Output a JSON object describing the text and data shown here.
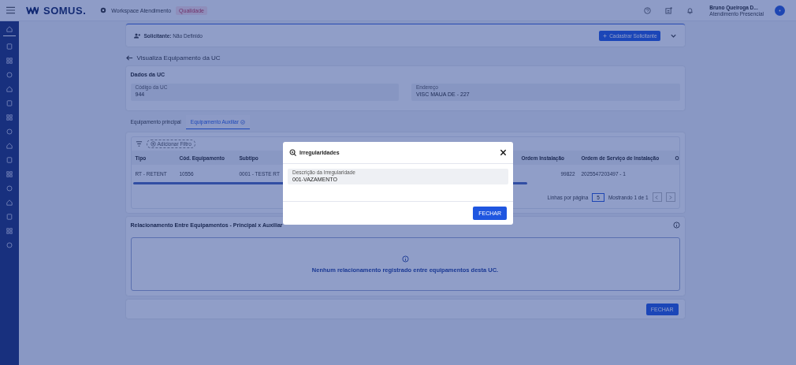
{
  "topbar": {
    "brand": "SOMUS.",
    "workspace": "Workspace Atendimento",
    "badge": "Qualidade",
    "user": {
      "name": "Bruno Queiroga D...",
      "role": "Atendimento Presencial"
    }
  },
  "sidebar": {
    "items": [
      {
        "selected": true
      },
      {
        "selected": false
      },
      {
        "selected": false
      },
      {
        "selected": false
      },
      {
        "selected": false
      },
      {
        "selected": false
      },
      {
        "selected": false
      },
      {
        "selected": false
      },
      {
        "selected": false
      },
      {
        "selected": false
      },
      {
        "selected": false
      },
      {
        "selected": false
      },
      {
        "selected": false
      },
      {
        "selected": false
      },
      {
        "selected": false
      },
      {
        "selected": false
      }
    ]
  },
  "requester": {
    "label": "Solicitante:",
    "value": "Não Definido",
    "button": "Cadastrar Solicitante"
  },
  "page_title": "Visualiza Equipamento da UC",
  "uc_data": {
    "title": "Dados da UC",
    "fields": [
      {
        "label": "Código da UC",
        "value": "944"
      },
      {
        "label": "Endereço",
        "value": "VISC MAUA DE - 227"
      }
    ]
  },
  "tabs": [
    {
      "label": "Equipamento principal",
      "selected": false
    },
    {
      "label": "Equipamento Auxiliar",
      "selected": true
    }
  ],
  "table": {
    "filter_button": "Adicionar Filtro",
    "columns": [
      {
        "label": "Tipo"
      },
      {
        "label": "Cód. Equipamento"
      },
      {
        "label": "Subtipo"
      },
      {
        "label": "Ordem Instalação"
      },
      {
        "label": "Ordem de Serviço de Instalação"
      },
      {
        "label": "O"
      }
    ],
    "rows": [
      {
        "cells": [
          "RT - RETENT",
          "10556",
          "0001 - TESTE RT",
          "99822",
          "2025547203497 - 1",
          ""
        ]
      }
    ],
    "pagination": {
      "rows_label": "Linhas por página",
      "rows_value": "5",
      "range": "Mostrando 1 de 1"
    }
  },
  "relationship": {
    "title": "Relacionamento Entre Equipamentos - Principal x Auxiliar",
    "empty_message": "Nenhum relacionamento registrado entre equipamentos desta UC."
  },
  "footer": {
    "button": "FECHAR"
  },
  "modal": {
    "title": "Irregularidades",
    "field": {
      "label": "Descrição da Irregularidade",
      "value": "001-VAZAMENTO"
    },
    "button": "FECHAR"
  }
}
